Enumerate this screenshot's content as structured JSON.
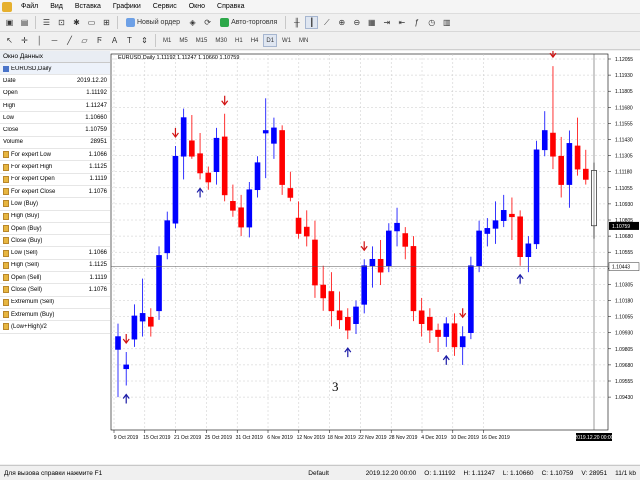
{
  "menu": [
    "Файл",
    "Вид",
    "Вставка",
    "Графики",
    "Сервис",
    "Окно",
    "Справка"
  ],
  "toolbar": {
    "new_order": "Новый ордер",
    "autotrading": "Авто-торговля"
  },
  "timeframes": [
    "M1",
    "M5",
    "M15",
    "M30",
    "H1",
    "H4",
    "D1",
    "W1",
    "MN"
  ],
  "active_timeframe": "D1",
  "data_window": {
    "title": "Окно Данных",
    "symbol": "EURUSD,Daily",
    "rows": [
      {
        "k": "Date",
        "v": "2019.12.20"
      },
      {
        "k": "Open",
        "v": "1.11192"
      },
      {
        "k": "High",
        "v": "1.11247"
      },
      {
        "k": "Low",
        "v": "1.10660"
      },
      {
        "k": "Close",
        "v": "1.10759"
      },
      {
        "k": "Volume",
        "v": "28951"
      }
    ],
    "indicators": [
      {
        "k": "For expert Low",
        "v": "1.1066"
      },
      {
        "k": "For expert High",
        "v": "1.1125"
      },
      {
        "k": "For expert Open",
        "v": "1.1119"
      },
      {
        "k": "For expert Close",
        "v": "1.1076"
      },
      {
        "k": "Low (Buy)",
        "v": ""
      },
      {
        "k": "High (Buy)",
        "v": ""
      },
      {
        "k": "Open (Buy)",
        "v": ""
      },
      {
        "k": "Close (Buy)",
        "v": ""
      },
      {
        "k": "Low (Sell)",
        "v": "1.1066"
      },
      {
        "k": "High (Sell)",
        "v": "1.1125"
      },
      {
        "k": "Open (Sell)",
        "v": "1.1119"
      },
      {
        "k": "Close (Sell)",
        "v": "1.1076"
      },
      {
        "k": "Extremum (Sell)",
        "v": ""
      },
      {
        "k": "Extremum (Buy)",
        "v": ""
      },
      {
        "k": "(Low+High)/2",
        "v": ""
      }
    ]
  },
  "chart": {
    "title": "EURUSD,Daily  1.11192 1.11247 1.10660 1.10759",
    "price_labels": [
      "1.12055",
      "1.11930",
      "1.11805",
      "1.11680",
      "1.11555",
      "1.11430",
      "1.11305",
      "1.11180",
      "1.11055",
      "1.10930",
      "1.10805",
      "1.10680",
      "1.10555",
      "1.10430",
      "1.10305",
      "1.10180",
      "1.10055",
      "1.09930",
      "1.09805",
      "1.09680",
      "1.09555",
      "1.09430"
    ],
    "date_labels": [
      "9 Oct 2019",
      "15 Oct 2019",
      "21 Oct 2019",
      "25 Oct 2019",
      "31 Oct 2019",
      "6 Nov 2019",
      "12 Nov 2019",
      "18 Nov 2019",
      "22 Nov 2019",
      "28 Nov 2019",
      "4 Dec 2019",
      "10 Dec 2019",
      "16 Dec 2019"
    ],
    "crosshair_price": "1.10443",
    "crosshair_date": "2019.12.20 00:00",
    "current_price": "1.10759",
    "annotation": "3",
    "colors": {
      "bull": "#0000ff",
      "bear": "#ff0000",
      "arrow_up": "#1a1aa6",
      "arrow_down": "#d11111",
      "grid": "#c8c8c8"
    }
  },
  "status": {
    "help": "Для вызова справки нажмите F1",
    "profile": "Default",
    "datetime": "2019.12.20 00:00",
    "open": "O: 1.11192",
    "high": "H: 1.11247",
    "low": "L: 1.10660",
    "close": "C: 1.10759",
    "volume": "V: 28951",
    "traffic": "11/1 kb"
  }
}
